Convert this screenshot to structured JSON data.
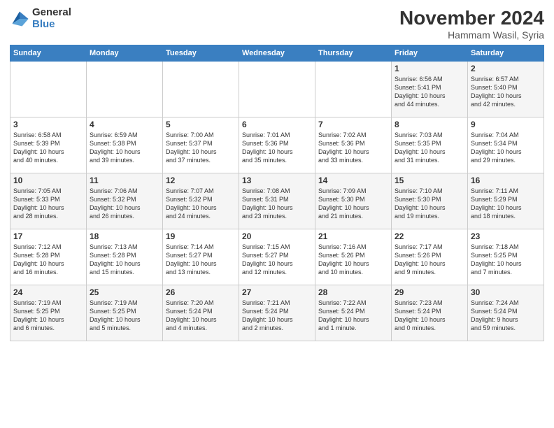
{
  "header": {
    "logo_general": "General",
    "logo_blue": "Blue",
    "title": "November 2024",
    "location": "Hammam Wasil, Syria"
  },
  "columns": [
    "Sunday",
    "Monday",
    "Tuesday",
    "Wednesday",
    "Thursday",
    "Friday",
    "Saturday"
  ],
  "weeks": [
    {
      "days": [
        {
          "num": "",
          "info": ""
        },
        {
          "num": "",
          "info": ""
        },
        {
          "num": "",
          "info": ""
        },
        {
          "num": "",
          "info": ""
        },
        {
          "num": "",
          "info": ""
        },
        {
          "num": "1",
          "info": "Sunrise: 6:56 AM\nSunset: 5:41 PM\nDaylight: 10 hours\nand 44 minutes."
        },
        {
          "num": "2",
          "info": "Sunrise: 6:57 AM\nSunset: 5:40 PM\nDaylight: 10 hours\nand 42 minutes."
        }
      ]
    },
    {
      "days": [
        {
          "num": "3",
          "info": "Sunrise: 6:58 AM\nSunset: 5:39 PM\nDaylight: 10 hours\nand 40 minutes."
        },
        {
          "num": "4",
          "info": "Sunrise: 6:59 AM\nSunset: 5:38 PM\nDaylight: 10 hours\nand 39 minutes."
        },
        {
          "num": "5",
          "info": "Sunrise: 7:00 AM\nSunset: 5:37 PM\nDaylight: 10 hours\nand 37 minutes."
        },
        {
          "num": "6",
          "info": "Sunrise: 7:01 AM\nSunset: 5:36 PM\nDaylight: 10 hours\nand 35 minutes."
        },
        {
          "num": "7",
          "info": "Sunrise: 7:02 AM\nSunset: 5:36 PM\nDaylight: 10 hours\nand 33 minutes."
        },
        {
          "num": "8",
          "info": "Sunrise: 7:03 AM\nSunset: 5:35 PM\nDaylight: 10 hours\nand 31 minutes."
        },
        {
          "num": "9",
          "info": "Sunrise: 7:04 AM\nSunset: 5:34 PM\nDaylight: 10 hours\nand 29 minutes."
        }
      ]
    },
    {
      "days": [
        {
          "num": "10",
          "info": "Sunrise: 7:05 AM\nSunset: 5:33 PM\nDaylight: 10 hours\nand 28 minutes."
        },
        {
          "num": "11",
          "info": "Sunrise: 7:06 AM\nSunset: 5:32 PM\nDaylight: 10 hours\nand 26 minutes."
        },
        {
          "num": "12",
          "info": "Sunrise: 7:07 AM\nSunset: 5:32 PM\nDaylight: 10 hours\nand 24 minutes."
        },
        {
          "num": "13",
          "info": "Sunrise: 7:08 AM\nSunset: 5:31 PM\nDaylight: 10 hours\nand 23 minutes."
        },
        {
          "num": "14",
          "info": "Sunrise: 7:09 AM\nSunset: 5:30 PM\nDaylight: 10 hours\nand 21 minutes."
        },
        {
          "num": "15",
          "info": "Sunrise: 7:10 AM\nSunset: 5:30 PM\nDaylight: 10 hours\nand 19 minutes."
        },
        {
          "num": "16",
          "info": "Sunrise: 7:11 AM\nSunset: 5:29 PM\nDaylight: 10 hours\nand 18 minutes."
        }
      ]
    },
    {
      "days": [
        {
          "num": "17",
          "info": "Sunrise: 7:12 AM\nSunset: 5:28 PM\nDaylight: 10 hours\nand 16 minutes."
        },
        {
          "num": "18",
          "info": "Sunrise: 7:13 AM\nSunset: 5:28 PM\nDaylight: 10 hours\nand 15 minutes."
        },
        {
          "num": "19",
          "info": "Sunrise: 7:14 AM\nSunset: 5:27 PM\nDaylight: 10 hours\nand 13 minutes."
        },
        {
          "num": "20",
          "info": "Sunrise: 7:15 AM\nSunset: 5:27 PM\nDaylight: 10 hours\nand 12 minutes."
        },
        {
          "num": "21",
          "info": "Sunrise: 7:16 AM\nSunset: 5:26 PM\nDaylight: 10 hours\nand 10 minutes."
        },
        {
          "num": "22",
          "info": "Sunrise: 7:17 AM\nSunset: 5:26 PM\nDaylight: 10 hours\nand 9 minutes."
        },
        {
          "num": "23",
          "info": "Sunrise: 7:18 AM\nSunset: 5:25 PM\nDaylight: 10 hours\nand 7 minutes."
        }
      ]
    },
    {
      "days": [
        {
          "num": "24",
          "info": "Sunrise: 7:19 AM\nSunset: 5:25 PM\nDaylight: 10 hours\nand 6 minutes."
        },
        {
          "num": "25",
          "info": "Sunrise: 7:19 AM\nSunset: 5:25 PM\nDaylight: 10 hours\nand 5 minutes."
        },
        {
          "num": "26",
          "info": "Sunrise: 7:20 AM\nSunset: 5:24 PM\nDaylight: 10 hours\nand 4 minutes."
        },
        {
          "num": "27",
          "info": "Sunrise: 7:21 AM\nSunset: 5:24 PM\nDaylight: 10 hours\nand 2 minutes."
        },
        {
          "num": "28",
          "info": "Sunrise: 7:22 AM\nSunset: 5:24 PM\nDaylight: 10 hours\nand 1 minute."
        },
        {
          "num": "29",
          "info": "Sunrise: 7:23 AM\nSunset: 5:24 PM\nDaylight: 10 hours\nand 0 minutes."
        },
        {
          "num": "30",
          "info": "Sunrise: 7:24 AM\nSunset: 5:24 PM\nDaylight: 9 hours\nand 59 minutes."
        }
      ]
    }
  ]
}
